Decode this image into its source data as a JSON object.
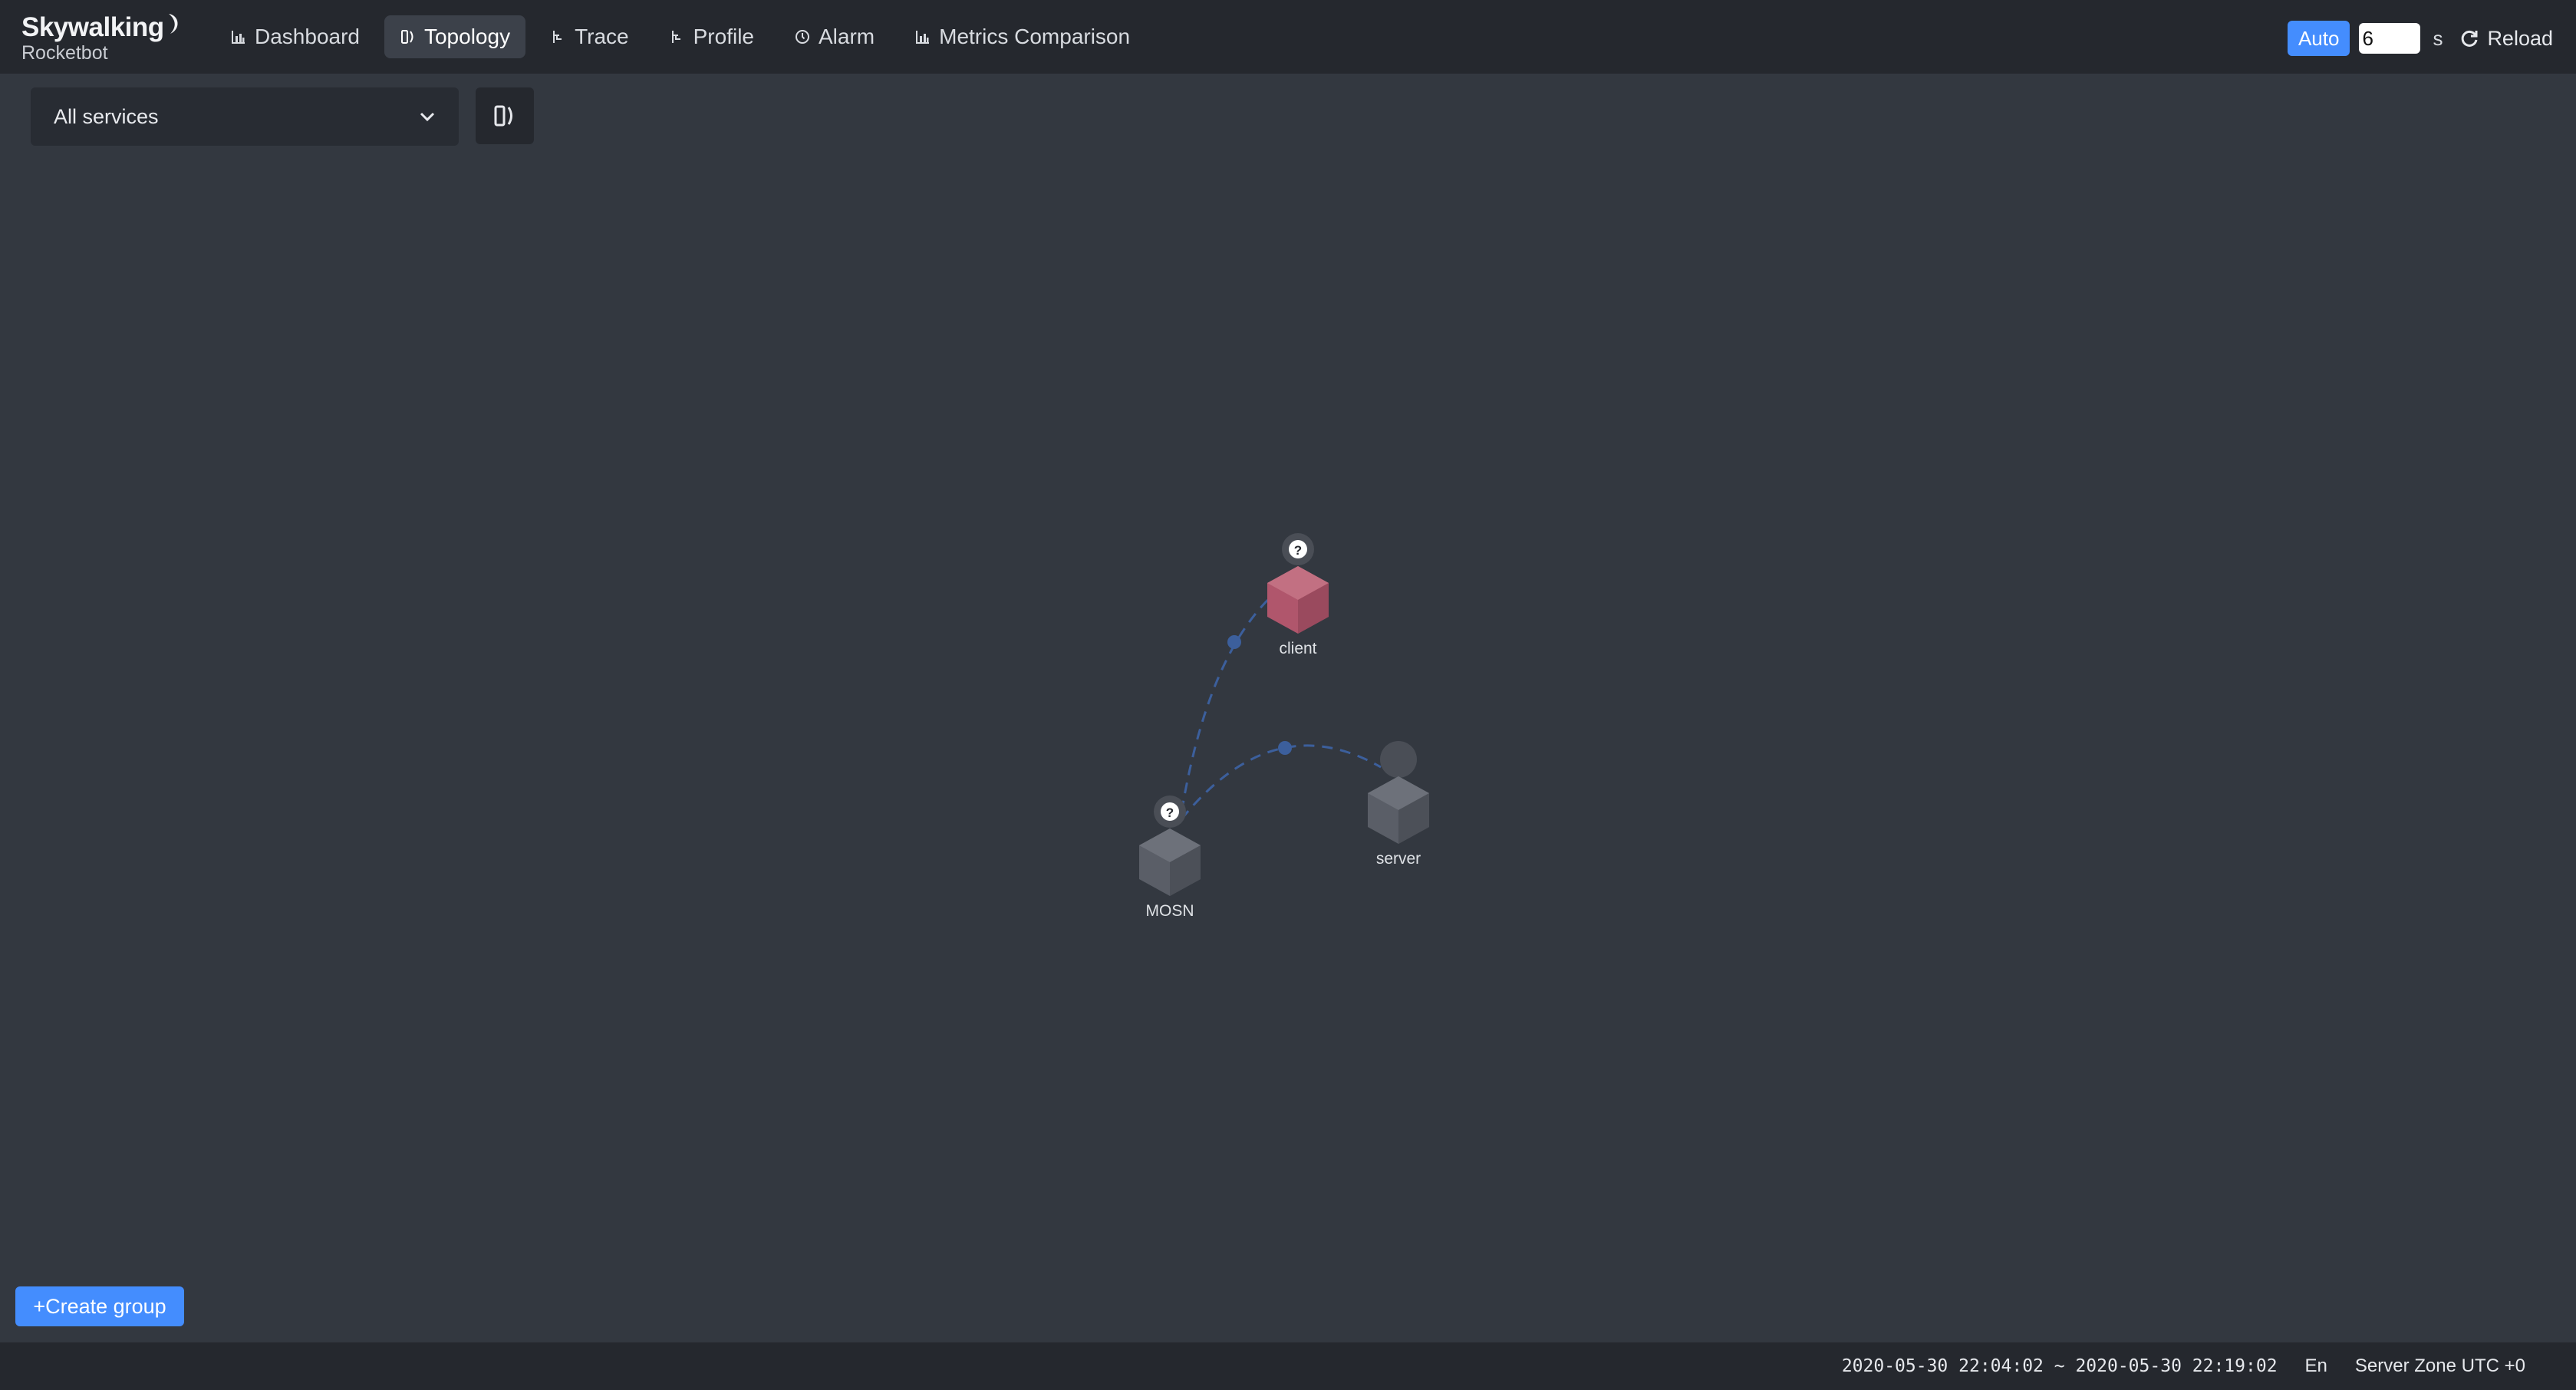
{
  "app": {
    "logo_title": "Skywalking",
    "logo_subtitle": "Rocketbot"
  },
  "nav": {
    "items": [
      {
        "label": "Dashboard",
        "icon": "bar-chart-icon",
        "active": false
      },
      {
        "label": "Topology",
        "icon": "topology-icon",
        "active": true
      },
      {
        "label": "Trace",
        "icon": "trace-icon",
        "active": false
      },
      {
        "label": "Profile",
        "icon": "profile-icon",
        "active": false
      },
      {
        "label": "Alarm",
        "icon": "alarm-icon",
        "active": false
      },
      {
        "label": "Metrics Comparison",
        "icon": "bar-chart-icon",
        "active": false
      }
    ]
  },
  "controls": {
    "auto_label": "Auto",
    "interval_value": "6",
    "interval_unit": "s",
    "reload_label": "Reload"
  },
  "toolbar": {
    "service_select_value": "All services",
    "layout_toggle_icon": "layout-icon"
  },
  "topology": {
    "nodes": [
      {
        "name": "client",
        "type": "user",
        "badge": "?",
        "color": "#b0566c"
      },
      {
        "name": "MOSN",
        "type": "service",
        "badge": "?",
        "color": "#5a5e67"
      },
      {
        "name": "server",
        "type": "service",
        "badge": "",
        "color": "#5a5e67"
      }
    ],
    "edges": [
      {
        "from": "client",
        "to": "MOSN"
      },
      {
        "from": "MOSN",
        "to": "server"
      }
    ]
  },
  "create_group_label": "+Create group",
  "footer": {
    "time_range": "2020-05-30 22:04:02 ~ 2020-05-30 22:19:02",
    "language": "En",
    "server_zone": "Server Zone UTC +0"
  },
  "colors": {
    "accent": "#448dfe",
    "background": "#333840",
    "header": "#25282e",
    "edge": "#3c5f9c"
  }
}
